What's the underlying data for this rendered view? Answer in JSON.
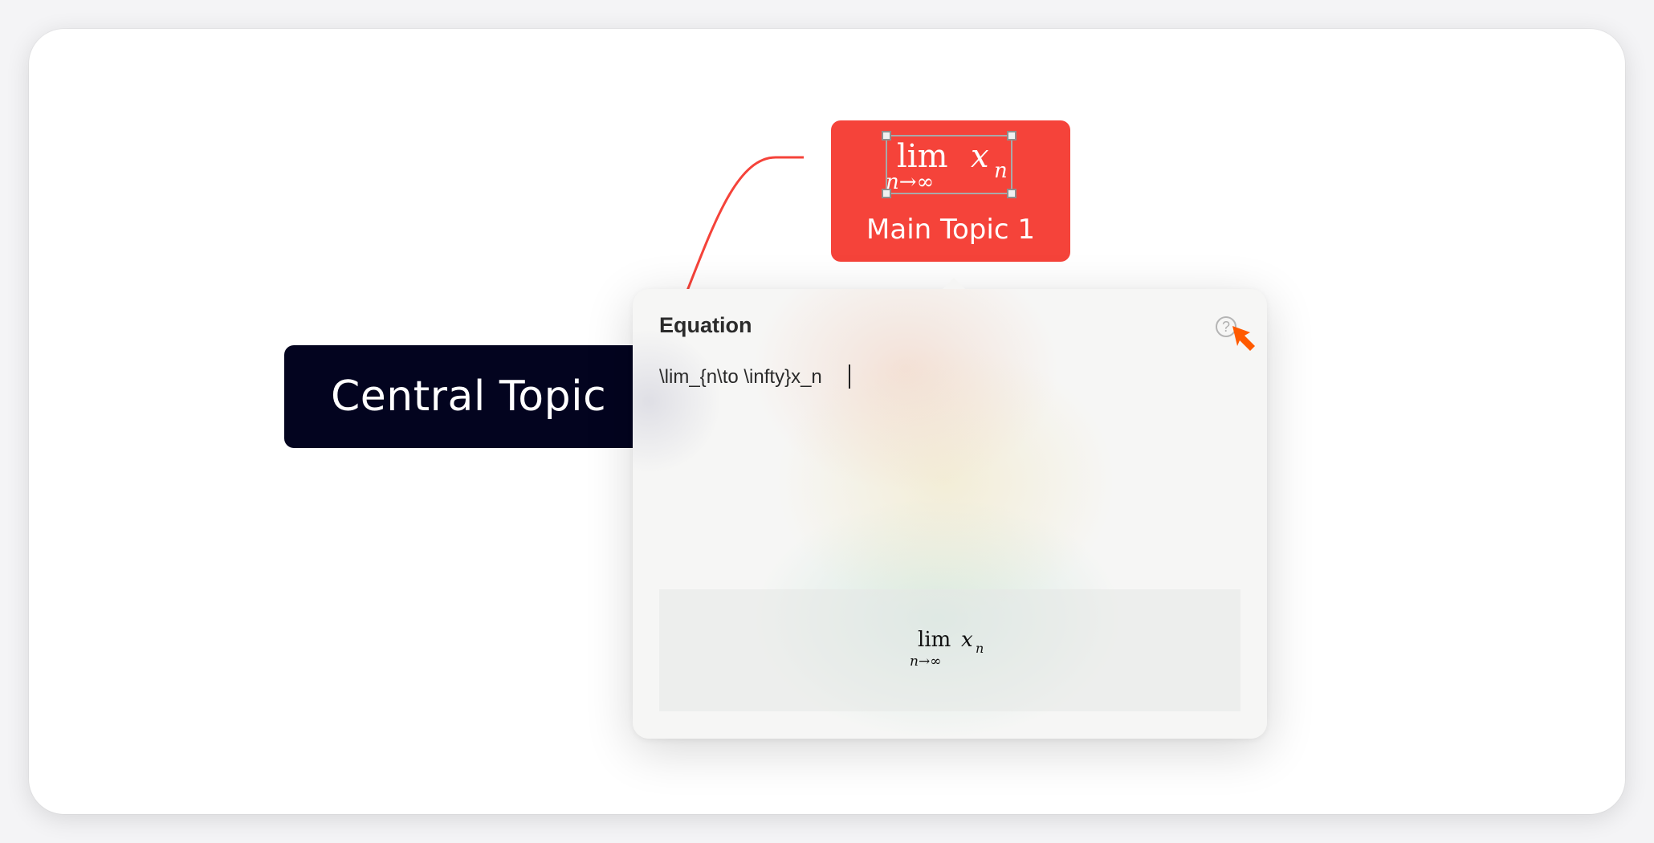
{
  "mind_map": {
    "central_topic": {
      "label": "Central Topic"
    },
    "main_topic": {
      "label": "Main Topic 1",
      "equation": {
        "lim": "lim",
        "subscript": "n→∞",
        "var": "x",
        "var_sub": "n"
      }
    },
    "connector_color": "#f5433a"
  },
  "equation_popover": {
    "title": "Equation",
    "help_icon_text": "?",
    "input_value": "\\lim_{n\\to \\infty}x_n",
    "preview": {
      "lim": "lim",
      "subscript": "n→∞",
      "var": "x",
      "var_sub": "n"
    }
  },
  "colors": {
    "central_topic_bg": "#03041f",
    "main_topic_bg": "#f5433a",
    "cursor": "#ff5a00"
  },
  "icons": [
    "help-icon",
    "pointer-cursor-icon"
  ]
}
